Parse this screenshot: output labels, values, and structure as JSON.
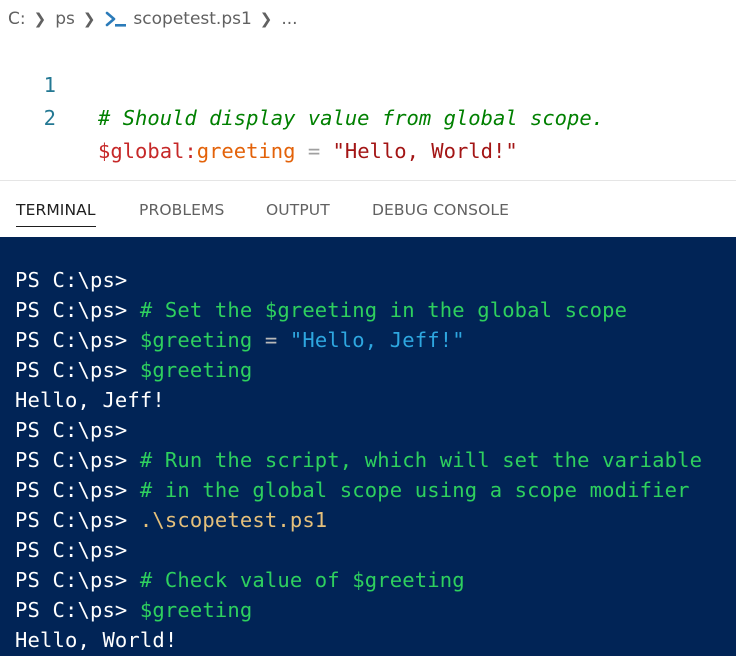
{
  "breadcrumb": {
    "drive": "C:",
    "folder": "ps",
    "file": "scopetest.ps1",
    "ellipsis": "..."
  },
  "editor": {
    "lines": [
      {
        "number": "1",
        "comment": "# Should display value from global scope."
      },
      {
        "number": "2",
        "var_dollar": "$global:",
        "var_name": "greeting",
        "op": " = ",
        "str": "\"Hello, World!\""
      }
    ]
  },
  "panel": {
    "tabs": [
      "TERMINAL",
      "PROBLEMS",
      "OUTPUT",
      "DEBUG CONSOLE"
    ],
    "active_tab": "TERMINAL"
  },
  "terminal": {
    "prompt": "PS C:\\ps> ",
    "lines": [
      {
        "prompt": "PS C:\\ps>"
      },
      {
        "prompt": "PS C:\\ps> ",
        "comment": "# Set the $greeting in the global scope"
      },
      {
        "prompt": "PS C:\\ps> ",
        "var": "$greeting",
        "op": " = ",
        "str": "\"Hello, Jeff!\""
      },
      {
        "prompt": "PS C:\\ps> ",
        "var": "$greeting"
      },
      {
        "output": "Hello, Jeff!"
      },
      {
        "prompt": "PS C:\\ps>"
      },
      {
        "prompt": "PS C:\\ps> ",
        "comment": "# Run the script, which will set the variable"
      },
      {
        "prompt": "PS C:\\ps> ",
        "comment": "# in the global scope using a scope modifier"
      },
      {
        "prompt": "PS C:\\ps> ",
        "cmd": ".\\scopetest.ps1"
      },
      {
        "prompt": "PS C:\\ps>"
      },
      {
        "prompt": "PS C:\\ps> ",
        "comment": "# Check value of $greeting"
      },
      {
        "prompt": "PS C:\\ps> ",
        "var": "$greeting"
      },
      {
        "output": "Hello, World!"
      }
    ]
  },
  "colors": {
    "terminal_bg": "#012456",
    "comment_green": "#2ed05e",
    "string_blue": "#2ea7e0",
    "command_yellow": "#e5c07b"
  }
}
